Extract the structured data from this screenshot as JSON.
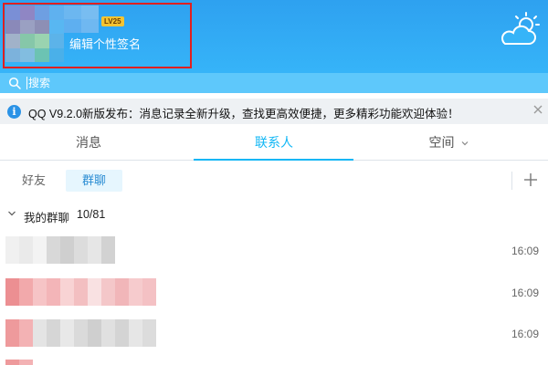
{
  "profile": {
    "level_badge": "LV25",
    "signature_placeholder": "编辑个性签名"
  },
  "header": {
    "weather_icon": "cloud-sun-icon"
  },
  "search": {
    "placeholder": "搜索"
  },
  "notice": {
    "text": "QQ V9.2.0新版发布：消息记录全新升级，查找更高效便捷，更多精彩功能欢迎体验！"
  },
  "tabs": [
    {
      "label": "消息"
    },
    {
      "label": "联系人"
    },
    {
      "label": "空间"
    }
  ],
  "subtabs": [
    {
      "label": "好友"
    },
    {
      "label": "群聊"
    }
  ],
  "group_section": {
    "name": "我的群聊",
    "count": "10/81"
  },
  "group_list": [
    {
      "time": "16:09"
    },
    {
      "time": "16:09"
    },
    {
      "time": "16:09"
    }
  ],
  "colors": {
    "accent": "#12b7f5",
    "header_blue": "#2ea1f0",
    "highlight_box": "#e02020"
  }
}
